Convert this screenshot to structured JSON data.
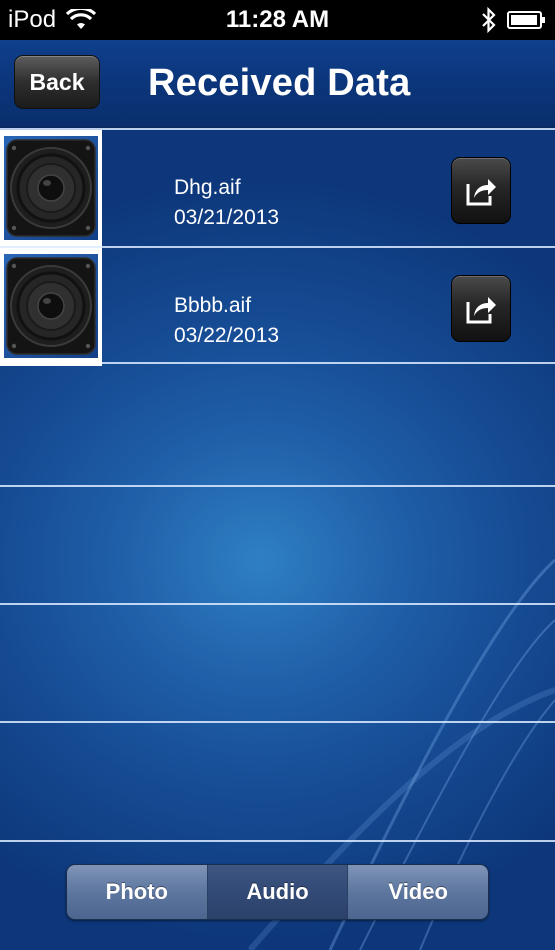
{
  "status_bar": {
    "carrier": "iPod",
    "time": "11:28 AM"
  },
  "nav": {
    "back_label": "Back",
    "title": "Received Data"
  },
  "files": [
    {
      "name": "Dhg.aif",
      "date": "03/21/2013",
      "icon": "speaker-icon"
    },
    {
      "name": "Bbbb.aif",
      "date": "03/22/2013",
      "icon": "speaker-icon"
    }
  ],
  "tabs": [
    {
      "label": "Photo",
      "selected": false
    },
    {
      "label": "Audio",
      "selected": true
    },
    {
      "label": "Video",
      "selected": false
    }
  ],
  "colors": {
    "background": "#1f5ea8",
    "nav_bar": "#0b3478",
    "status_bar": "#000000",
    "separator": "#dcebff"
  }
}
